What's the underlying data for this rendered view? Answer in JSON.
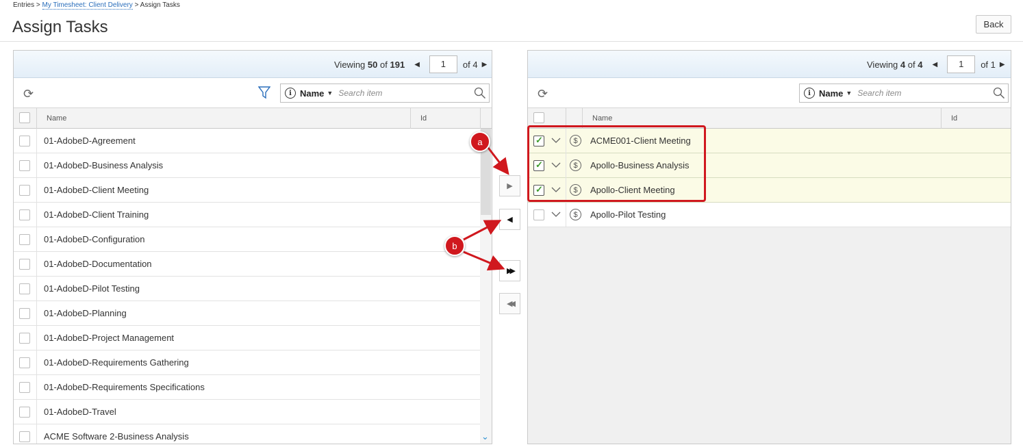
{
  "breadcrumb": {
    "root": "Entries",
    "sep1": " > ",
    "link": "My Timesheet: Client Delivery",
    "sep2": " > ",
    "current": "Assign Tasks"
  },
  "page_title": "Assign Tasks",
  "back_label": "Back",
  "left": {
    "viewing_label": "Viewing",
    "viewing_count": "50",
    "of_word": "of",
    "total": "191",
    "page": "1",
    "of_pages": "of 4",
    "search": {
      "field": "Name",
      "placeholder": "Search item"
    },
    "columns": {
      "name": "Name",
      "id": "Id"
    },
    "rows": [
      "01-AdobeD-Agreement",
      "01-AdobeD-Business Analysis",
      "01-AdobeD-Client Meeting",
      "01-AdobeD-Client Training",
      "01-AdobeD-Configuration",
      "01-AdobeD-Documentation",
      "01-AdobeD-Pilot Testing",
      "01-AdobeD-Planning",
      "01-AdobeD-Project Management",
      "01-AdobeD-Requirements Gathering",
      "01-AdobeD-Requirements Specifications",
      "01-AdobeD-Travel",
      "ACME Software 2-Business Analysis"
    ]
  },
  "right": {
    "viewing_label": "Viewing",
    "viewing_count": "4",
    "of_word": "of",
    "total": "4",
    "page": "1",
    "of_pages": "of 1",
    "search": {
      "field": "Name",
      "placeholder": "Search item"
    },
    "columns": {
      "name": "Name",
      "id": "Id"
    },
    "rows": [
      {
        "label": "ACME001-Client Meeting",
        "checked": true
      },
      {
        "label": "Apollo-Business Analysis",
        "checked": true
      },
      {
        "label": "Apollo-Client Meeting",
        "checked": true
      },
      {
        "label": "Apollo-Pilot Testing",
        "checked": false
      }
    ]
  },
  "annotations": {
    "a": "a",
    "b": "b"
  },
  "colors": {
    "accent": "#2a6ebb",
    "annotation_red": "#d0181e",
    "selected_row": "#fbfbe6",
    "check_green": "#3c9b2a"
  }
}
